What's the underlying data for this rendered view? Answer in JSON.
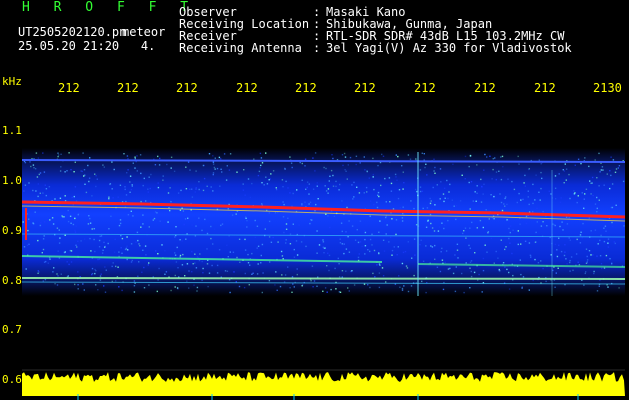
{
  "header": {
    "brand": "H R O F F T",
    "file_name": "UT2505202120.pn",
    "file_tag": "meteor",
    "datetime": "25.05.20 21:20",
    "counter": "4.",
    "info": [
      {
        "key": "Observer",
        "value": "Masaki Kano"
      },
      {
        "key": "Receiving Location",
        "value": "Shibukawa, Gunma, Japan"
      },
      {
        "key": "Receiver",
        "value": "RTL-SDR SDR# 43dB L15 103.2MHz CW"
      },
      {
        "key": "Receiving Antenna",
        "value": "3el Yagi(V) Az 330 for Vladivostok"
      }
    ],
    "separator": ":"
  },
  "axes": {
    "y_unit": "kHz",
    "y_ticks": [
      "1.1",
      "1.0",
      "0.9",
      "0.8",
      "0.7",
      "0.6"
    ],
    "x_ticks": [
      "212",
      "212",
      "212",
      "212",
      "212",
      "212",
      "212",
      "212",
      "212",
      "2130"
    ]
  },
  "colors": {
    "text_yellow": "#ffff00",
    "text_green": "#33ff33",
    "background": "#000000",
    "noise_blue": "#0a2bd6",
    "signal_red": "#ff2020",
    "grid_cyan": "#00c8ff",
    "amplitude_yellow": "#ffff00"
  }
}
